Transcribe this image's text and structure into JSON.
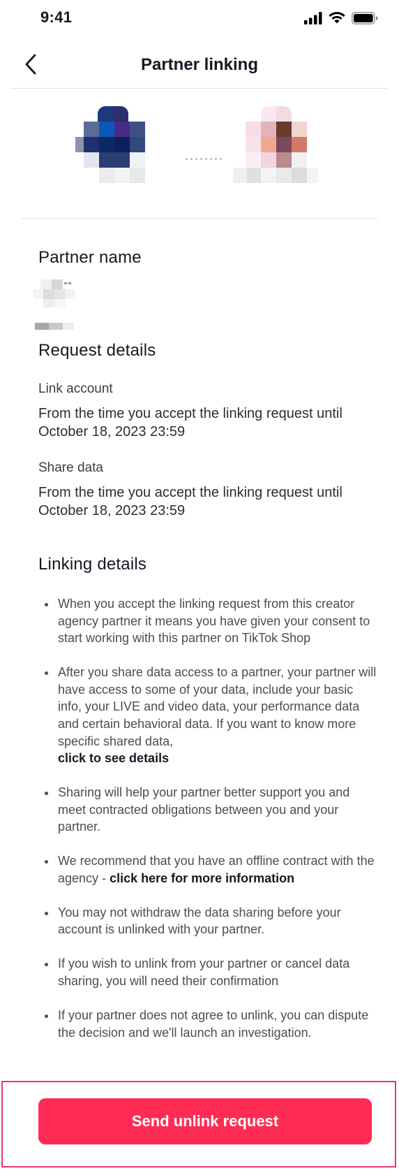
{
  "status_bar": {
    "time": "9:41"
  },
  "nav": {
    "title": "Partner linking"
  },
  "partner_section": {
    "title": "Partner name"
  },
  "request_details": {
    "title": "Request details",
    "link_account": {
      "label": "Link account",
      "text": "From the time you accept the linking request until October 18, 2023 23:59"
    },
    "share_data": {
      "label": "Share data",
      "text": "From the time you accept the linking request until October 18, 2023 23:59"
    }
  },
  "linking_details": {
    "title": "Linking details",
    "bullet_1": "When you accept the linking request from this creator agency partner it means you have given your consent to start working with this partner on TikTok Shop",
    "bullet_2": "After you share data access to a partner, your partner will have access to some of your data, include your basic info, your LIVE and video data, your performance data and certain behavioral data. If you want to know more specific shared data,",
    "bullet_2_link": "click to see details",
    "bullet_3": "Sharing will help your partner better support you and meet contracted obligations between you and your partner.",
    "bullet_4": "We recommend that you have an offline contract with the agency -",
    "bullet_4_link": "click here for more information",
    "bullet_5": "You may not withdraw the data sharing before your account is unlinked with your partner.",
    "bullet_6": "If you wish to unlink from your partner or cancel data sharing, you will need their confirmation",
    "bullet_7": "If your partner does not agree to unlink, you can dispute the decision and we'll launch an investigation."
  },
  "footer": {
    "button_label": "Send unlink request"
  },
  "colors": {
    "brand": "#fe2c55",
    "highlight": "#e3396a",
    "text": "#161823"
  }
}
